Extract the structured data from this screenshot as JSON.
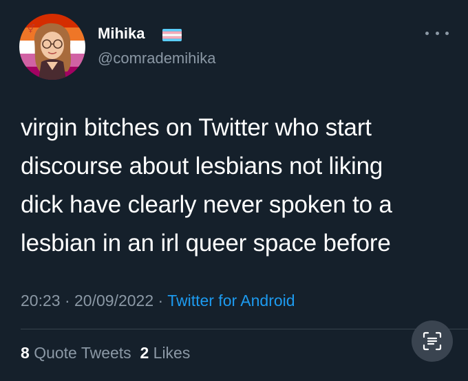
{
  "author": {
    "name": "Mihika",
    "handle": "@comrademihika",
    "flag_icon": "trans-flag-icon",
    "avatar_icon": "illustrated-avatar-with-lesbian-flag-background"
  },
  "tweet": {
    "lines": [
      "virgin bitches on Twitter who start",
      "discourse about lesbians not liking",
      "dick have clearly never spoken to a",
      "lesbian in an irl queer space before"
    ]
  },
  "meta": {
    "time": "20:23",
    "separator": "·",
    "date": "20/09/2022",
    "source": "Twitter for Android"
  },
  "stats": {
    "quote_count": "8",
    "quote_label": "Quote Tweets",
    "like_count": "2",
    "like_label": "Likes"
  },
  "colors": {
    "background": "#15202b",
    "text": "#ffffff",
    "secondary": "#8b98a5",
    "link": "#1d9bf0",
    "divider": "#38444d"
  }
}
